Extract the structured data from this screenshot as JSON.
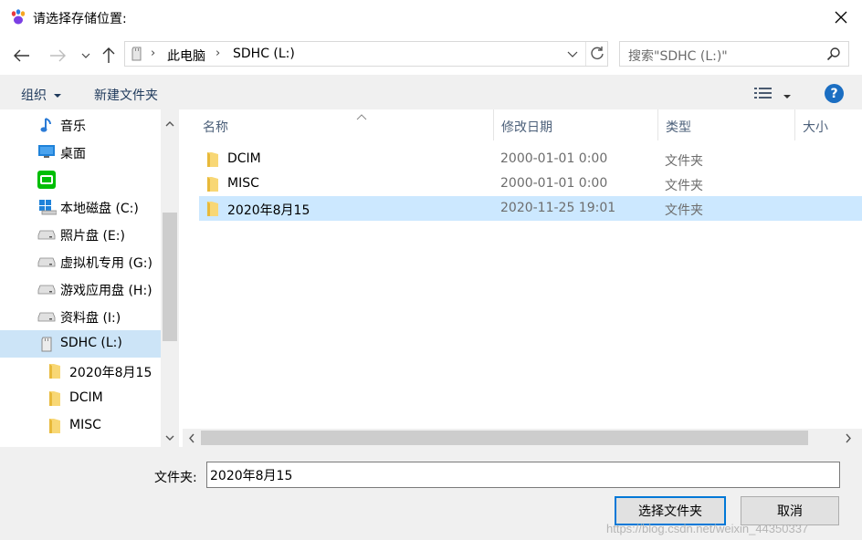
{
  "title": "请选择存储位置:",
  "address": {
    "crumbs": [
      "此电脑",
      "SDHC (L:)"
    ]
  },
  "search": {
    "placeholder": "搜索\"SDHC (L:)\""
  },
  "toolbar": {
    "organize": "组织",
    "new_folder": "新建文件夹",
    "help": "?"
  },
  "nav": {
    "items": [
      {
        "label": "音乐",
        "icon": "music-note-icon"
      },
      {
        "label": "桌面",
        "icon": "desktop-icon"
      },
      {
        "label": "",
        "icon": "iqiyi-app-icon"
      },
      {
        "label": "本地磁盘 (C:)",
        "icon": "windows-drive-icon"
      },
      {
        "label": "照片盘 (E:)",
        "icon": "drive-icon"
      },
      {
        "label": "虚拟机专用 (G:)",
        "icon": "drive-icon"
      },
      {
        "label": "游戏应用盘 (H:)",
        "icon": "drive-icon"
      },
      {
        "label": "资料盘 (I:)",
        "icon": "drive-icon"
      },
      {
        "label": "SDHC (L:)",
        "icon": "sd-card-icon",
        "selected": true
      },
      {
        "label": "2020年8月15",
        "icon": "folder-icon"
      },
      {
        "label": "DCIM",
        "icon": "folder-icon"
      },
      {
        "label": "MISC",
        "icon": "folder-icon"
      }
    ]
  },
  "columns": [
    "名称",
    "修改日期",
    "类型",
    "大小"
  ],
  "files": [
    {
      "name": "DCIM",
      "date": "2000-01-01 0:00",
      "type": "文件夹"
    },
    {
      "name": "MISC",
      "date": "2000-01-01 0:00",
      "type": "文件夹"
    },
    {
      "name": "2020年8月15",
      "date": "2020-11-25 19:01",
      "type": "文件夹",
      "selected": true
    }
  ],
  "folder_field": {
    "label": "文件夹:",
    "value": "2020年8月15"
  },
  "buttons": {
    "select_folder": "选择文件夹",
    "cancel": "取消"
  },
  "watermark": "https://blog.csdn.net/weixin_44350337",
  "colors": {
    "accent": "#0078d7",
    "selection": "#cce8ff",
    "toolbar_bg": "#f0f0f0"
  }
}
